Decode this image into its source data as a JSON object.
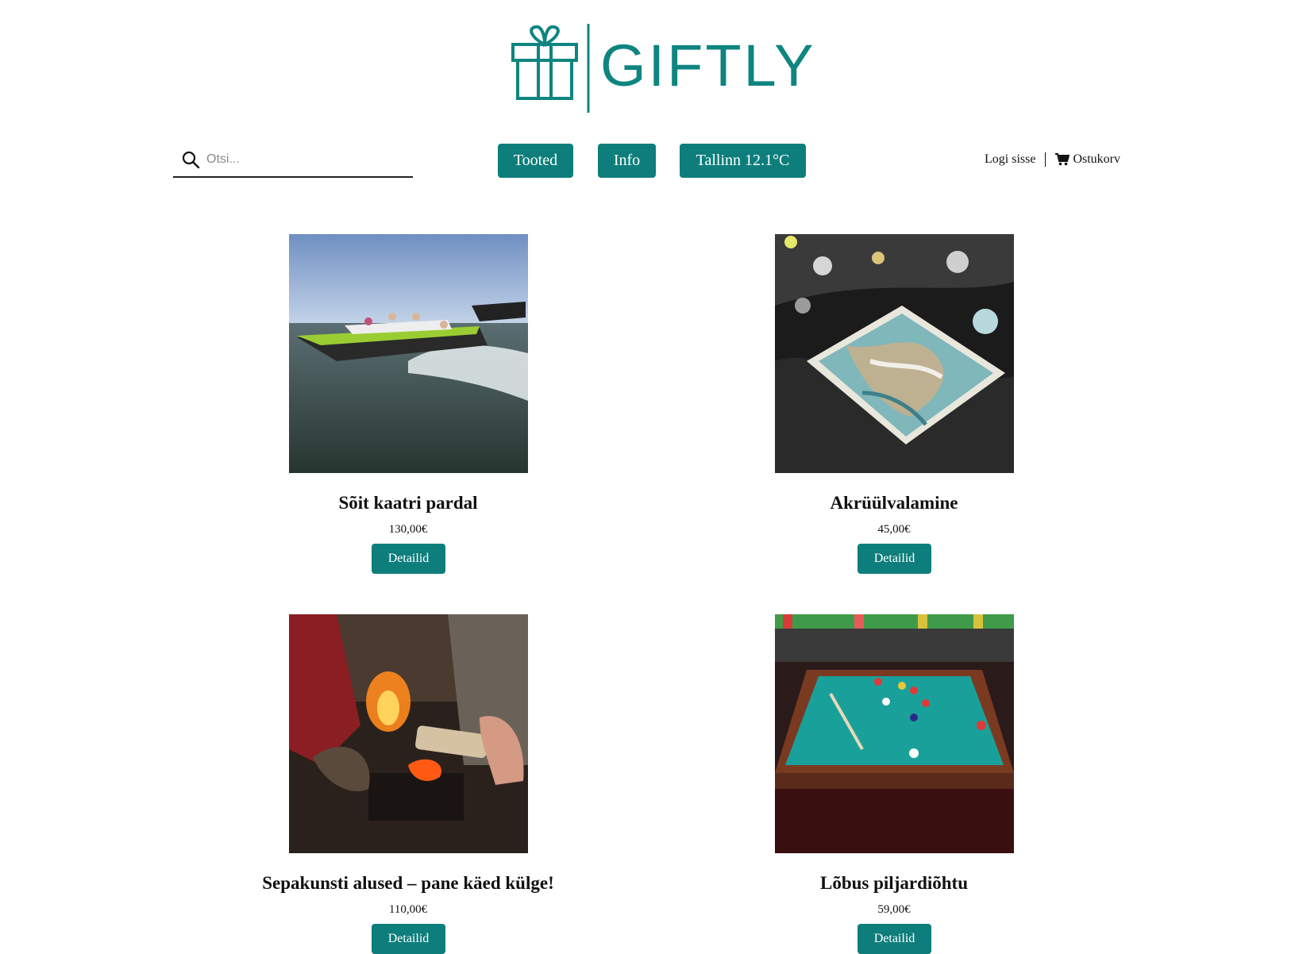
{
  "brand": {
    "name": "GIFTLY",
    "color": "#0e8580",
    "logo_icon": "gift-box-icon"
  },
  "search": {
    "placeholder": "Otsi...",
    "icon": "search-icon"
  },
  "nav": {
    "products": "Tooted",
    "info": "Info",
    "weather": "Tallinn 12.1°C"
  },
  "account": {
    "login": "Logi sisse",
    "cart": "Ostukorv",
    "cart_icon": "shopping-cart-icon"
  },
  "accent_color": "#0e7e7c",
  "products": [
    {
      "title": "Sõit kaatri pardal",
      "price": "130,00€",
      "button": "Detailid",
      "image": "speedboat-photo"
    },
    {
      "title": "Akrüülvalamine",
      "price": "45,00€",
      "button": "Detailid",
      "image": "acrylic-pouring-photo"
    },
    {
      "title": "Sepakunsti alused – pane käed külge!",
      "price": "110,00€",
      "button": "Detailid",
      "image": "blacksmith-forge-photo"
    },
    {
      "title": "Lõbus piljardiõhtu",
      "price": "59,00€",
      "button": "Detailid",
      "image": "billiard-table-photo"
    }
  ]
}
